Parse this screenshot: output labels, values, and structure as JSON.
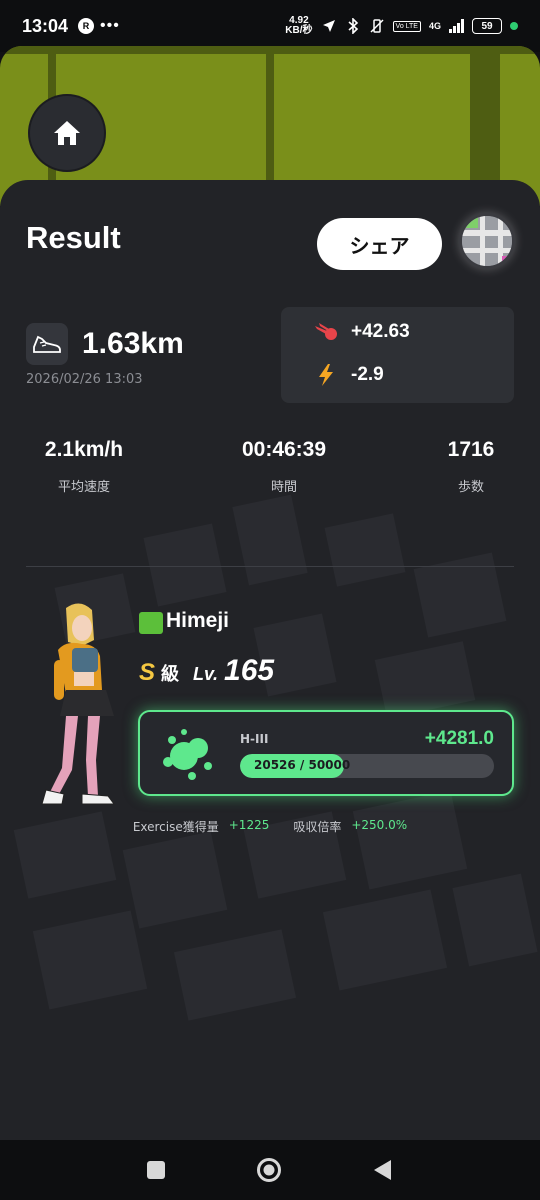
{
  "status_bar": {
    "time": "13:04",
    "r_badge": "R",
    "more": "•••",
    "net_speed_value": "4.92",
    "net_speed_unit": "KB/秒",
    "volte_label": "Vo LTE",
    "network_type": "4G",
    "battery": "59"
  },
  "header": {
    "title": "Result",
    "share_label": "シェア"
  },
  "workout": {
    "distance": "1.63km",
    "datetime": "2026/02/26 13:03",
    "gain_primary": "+42.63",
    "gain_secondary": "-2.9"
  },
  "stats": [
    {
      "value": "2.1km/h",
      "label": "平均速度"
    },
    {
      "value": "00:46:39",
      "label": "時間"
    },
    {
      "value": "1716",
      "label": "歩数"
    }
  ],
  "character": {
    "name": "Himeji",
    "rank_letter": "S",
    "rank_suffix": "級",
    "level_prefix": "Lv.",
    "level": "165"
  },
  "exp": {
    "tier": "H-III",
    "gain": "+4281.0",
    "progress_text": "20526 / 50000",
    "progress_fraction": 0.41
  },
  "footer": {
    "exercise_label": "Exercise獲得量",
    "exercise_value": "+1225",
    "absorb_label": "吸収倍率",
    "absorb_value": "+250.0%"
  },
  "colors": {
    "accent_green": "#5ee88d",
    "rank_gold": "#f5c842",
    "map_olive": "#7a8f1a"
  }
}
